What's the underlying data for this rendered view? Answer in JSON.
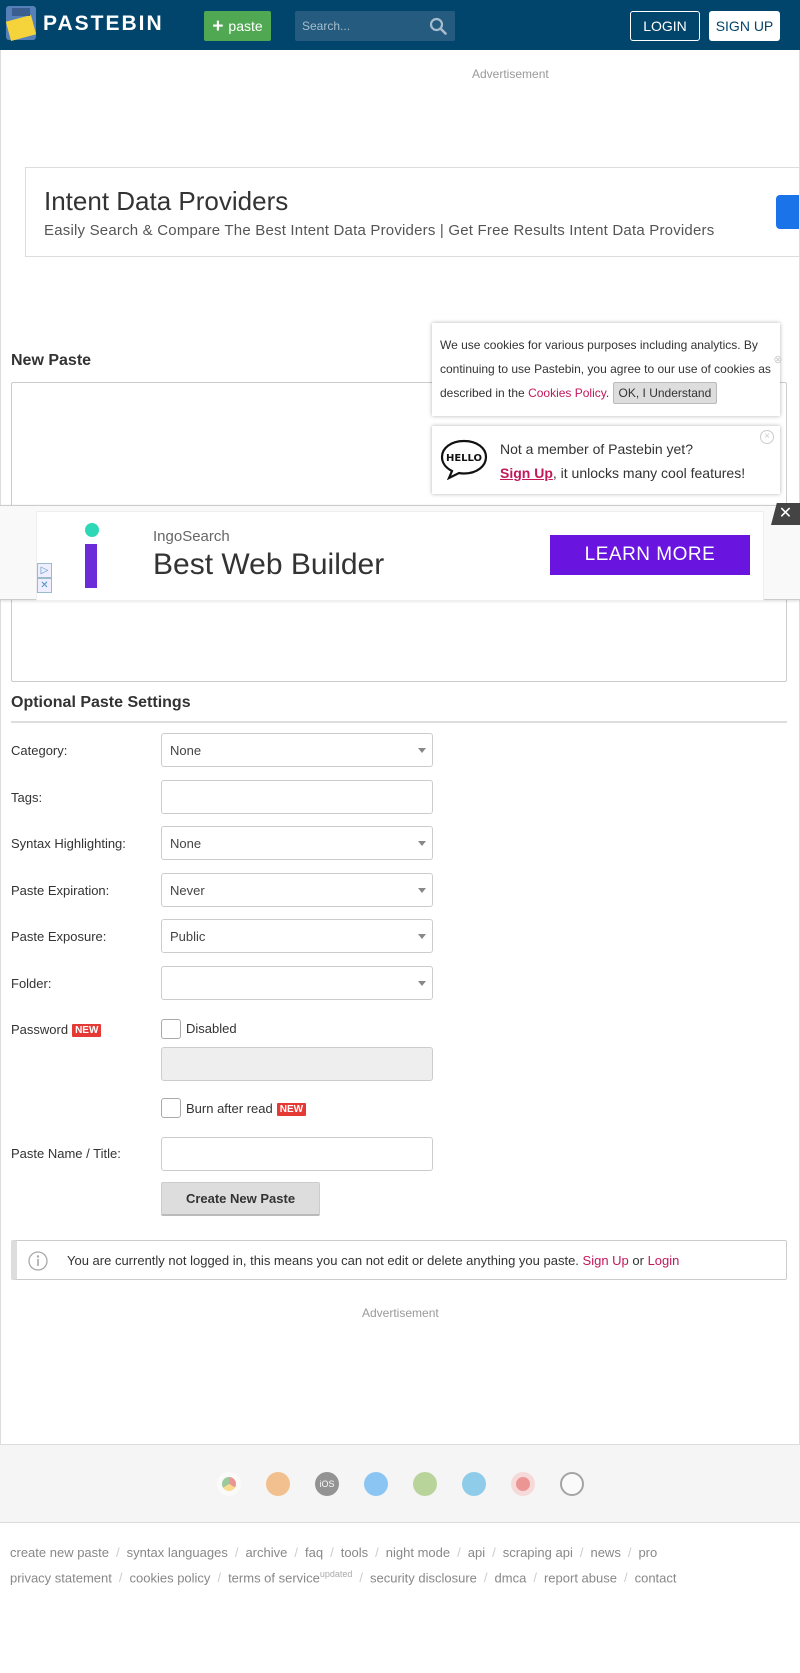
{
  "header": {
    "logo_text": "PASTEBIN",
    "paste_button_label": "paste",
    "search_placeholder": "Search...",
    "login_label": "LOGIN",
    "signup_label": "SIGN UP"
  },
  "ads": {
    "top_label": "Advertisement",
    "banner_title": "Intent Data Providers",
    "banner_desc": "Easily Search & Compare The Best Intent Data Providers | Get Free Results Intent Data Providers",
    "bottom_label": "Advertisement",
    "sticky_sub": "IngoSearch",
    "sticky_title": "Best Web Builder",
    "sticky_cta": "LEARN MORE",
    "sticky_close": "✕",
    "adchoices_play": "▷",
    "adchoices_close": "✕"
  },
  "new_paste": {
    "title": "New Paste"
  },
  "cookie": {
    "text_before": "We use cookies for various purposes including analytics. By continuing to use Pastebin, you agree to our use of cookies as described in the ",
    "link": "Cookies Policy",
    "text_after": ". ",
    "ok_label": "OK, I Understand"
  },
  "hello_popup": {
    "line1": "Not a member of Pastebin yet?",
    "signup_link": "Sign Up",
    "line2_rest": ", it unlocks many cool features!",
    "close": "×"
  },
  "settings": {
    "title": "Optional Paste Settings",
    "category_label": "Category:",
    "category_value": "None",
    "tags_label": "Tags:",
    "syntax_label": "Syntax Highlighting:",
    "syntax_value": "None",
    "expiration_label": "Paste Expiration:",
    "expiration_value": "Never",
    "exposure_label": "Paste Exposure:",
    "exposure_value": "Public",
    "folder_label": "Folder:",
    "folder_value": "",
    "password_label": "Password",
    "new_badge": "NEW",
    "password_checkbox_label": "Disabled",
    "burn_label": "Burn after read",
    "name_label": "Paste Name / Title:",
    "create_button": "Create New Paste"
  },
  "notice": {
    "text": "You are currently not logged in, this means you can not edit or delete anything you paste. ",
    "signup": "Sign Up",
    "or": " or ",
    "login": "Login"
  },
  "app_icons": [
    "chrome-icon",
    "firefox-icon",
    "ios-icon",
    "windows-icon",
    "android-icon",
    "mac-icon",
    "opera-icon",
    "linux-icon"
  ],
  "footer": {
    "row1": [
      "create new paste",
      "syntax languages",
      "archive",
      "faq",
      "tools",
      "night mode",
      "api",
      "scraping api",
      "news",
      "pro"
    ],
    "row2": [
      "privacy statement",
      "cookies policy",
      "terms of service",
      "security disclosure",
      "dmca",
      "report abuse",
      "contact"
    ],
    "updated_sup": "updated"
  },
  "colors": {
    "header_bg": "#02456c",
    "paste_green": "#50a852",
    "link_red": "#c2185b",
    "badge_red": "#e53935",
    "cta_purple": "#6a14e0"
  }
}
